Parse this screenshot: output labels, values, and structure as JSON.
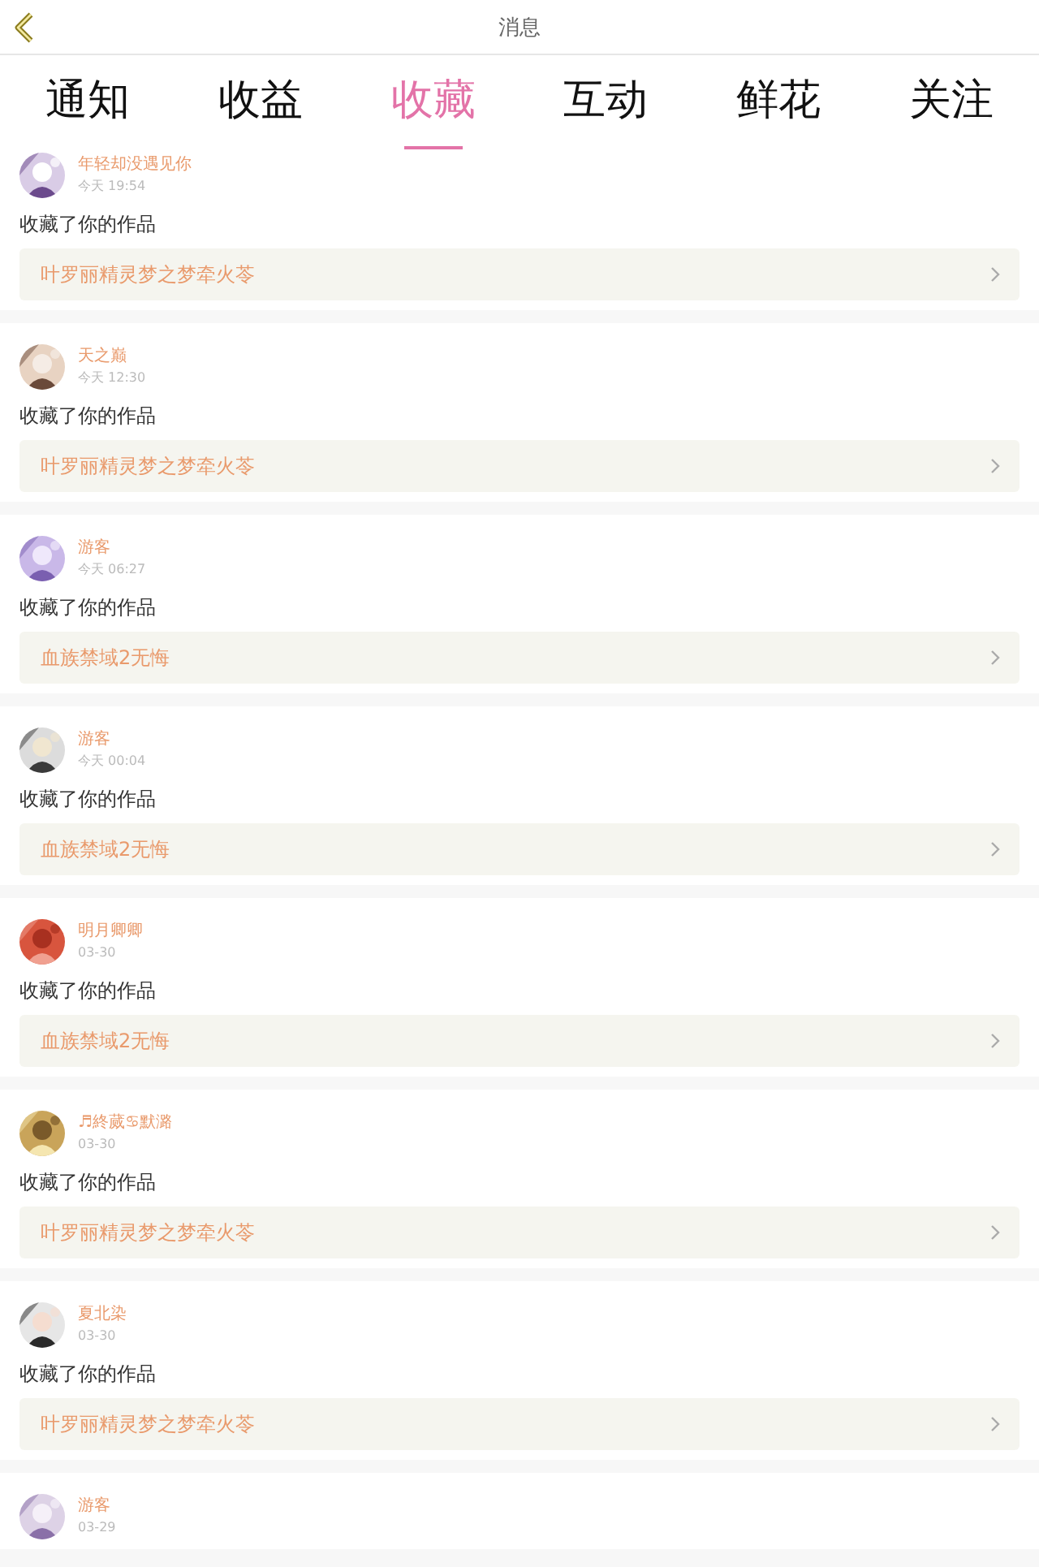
{
  "header": {
    "title": "消息"
  },
  "tabs": [
    {
      "label": "通知",
      "selected": false
    },
    {
      "label": "收益",
      "selected": false
    },
    {
      "label": "收藏",
      "selected": true
    },
    {
      "label": "互动",
      "selected": false
    },
    {
      "label": "鲜花",
      "selected": false
    },
    {
      "label": "关注",
      "selected": false
    }
  ],
  "messages": [
    {
      "user": "年轻却没遇见你",
      "time": "今天 19:54",
      "action": "收藏了你的作品",
      "work": "叶罗丽精灵梦之梦牵火苓"
    },
    {
      "user": "天之巅",
      "time": "今天 12:30",
      "action": "收藏了你的作品",
      "work": "叶罗丽精灵梦之梦牵火苓"
    },
    {
      "user": "游客",
      "time": "今天 06:27",
      "action": "收藏了你的作品",
      "work": "血族禁域2无悔"
    },
    {
      "user": "游客",
      "time": "今天 00:04",
      "action": "收藏了你的作品",
      "work": "血族禁域2无悔"
    },
    {
      "user": "明月卿卿",
      "time": "03-30",
      "action": "收藏了你的作品",
      "work": "血族禁域2无悔"
    },
    {
      "user": "♬終蒇♋默潞",
      "time": "03-30",
      "action": "收藏了你的作品",
      "work": "叶罗丽精灵梦之梦牵火苓"
    },
    {
      "user": "夏北染",
      "time": "03-30",
      "action": "收藏了你的作品",
      "work": "叶罗丽精灵梦之梦牵火苓"
    },
    {
      "user": "游客",
      "time": "03-29"
    }
  ]
}
